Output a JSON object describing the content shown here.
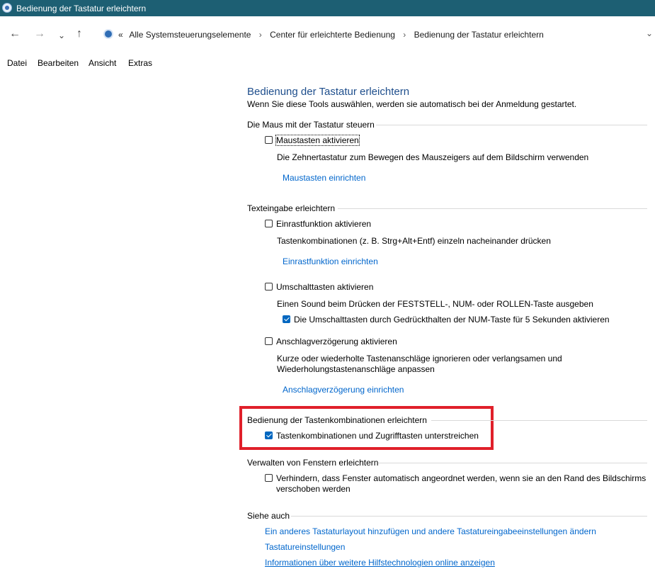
{
  "window": {
    "title": "Bedienung der Tastatur erleichtern"
  },
  "nav": {
    "back_icon": "←",
    "forward_icon": "→",
    "recent_icon": "⌄",
    "up_icon": "↑"
  },
  "address": {
    "prefix": "«",
    "crumbs": [
      "Alle Systemsteuerungselemente",
      "Center für erleichterte Bedienung",
      "Bedienung der Tastatur erleichtern"
    ],
    "separator": "›",
    "dropdown": "⌄"
  },
  "menu": [
    "Datei",
    "Bearbeiten",
    "Ansicht",
    "Extras"
  ],
  "page": {
    "heading": "Bedienung der Tastatur erleichtern",
    "subtitle": "Wenn Sie diese Tools auswählen, werden sie automatisch bei der Anmeldung gestartet."
  },
  "mouse": {
    "section": "Die Maus mit der Tastatur steuern",
    "checkbox_label": "Maustasten aktivieren",
    "checked": false,
    "description": "Die Zehnertastatur zum Bewegen des Mauszeigers auf dem Bildschirm verwenden",
    "link": "Maustasten einrichten"
  },
  "typing": {
    "section": "Texteingabe erleichtern",
    "sticky": {
      "label": "Einrastfunktion aktivieren",
      "checked": false,
      "description": "Tastenkombinationen (z. B. Strg+Alt+Entf) einzeln nacheinander drücken",
      "link": "Einrastfunktion einrichten"
    },
    "toggle": {
      "label": "Umschalttasten aktivieren",
      "checked": false,
      "description": "Einen Sound beim Drücken der FESTSTELL-, NUM- oder ROLLEN-Taste ausgeben",
      "sub_label": "Die Umschalttasten durch Gedrückthalten der NUM-Taste für 5 Sekunden aktivieren",
      "sub_checked": true
    },
    "filter": {
      "label": "Anschlagverzögerung aktivieren",
      "checked": false,
      "description_line1": "Kurze oder wiederholte Tastenanschläge ignorieren oder verlangsamen und",
      "description_line2": "Wiederholungstastenanschläge anpassen",
      "link": "Anschlagverzögerung einrichten"
    }
  },
  "shortcuts": {
    "section": "Bedienung der Tastenkombinationen erleichtern",
    "label": "Tastenkombinationen und Zugrifftasten unterstreichen",
    "checked": true,
    "highlight_color": "#e0202a"
  },
  "windows": {
    "section": "Verwalten von Fenstern erleichtern",
    "label_line1": "Verhindern, dass Fenster automatisch angeordnet werden, wenn sie an den Rand des Bildschirms",
    "label_line2": "verschoben werden",
    "checked": false
  },
  "see_also": {
    "section": "Siehe auch",
    "links": [
      "Ein anderes Tastaturlayout hinzufügen und andere Tastatureingabeeinstellungen ändern",
      "Tastatureinstellungen",
      "Informationen über weitere Hilfstechnologien online anzeigen"
    ]
  },
  "colors": {
    "titlebar": "#1d5f73",
    "link": "#0066cc",
    "heading": "#1e4e8c",
    "checkbox_checked": "#0067c0"
  }
}
